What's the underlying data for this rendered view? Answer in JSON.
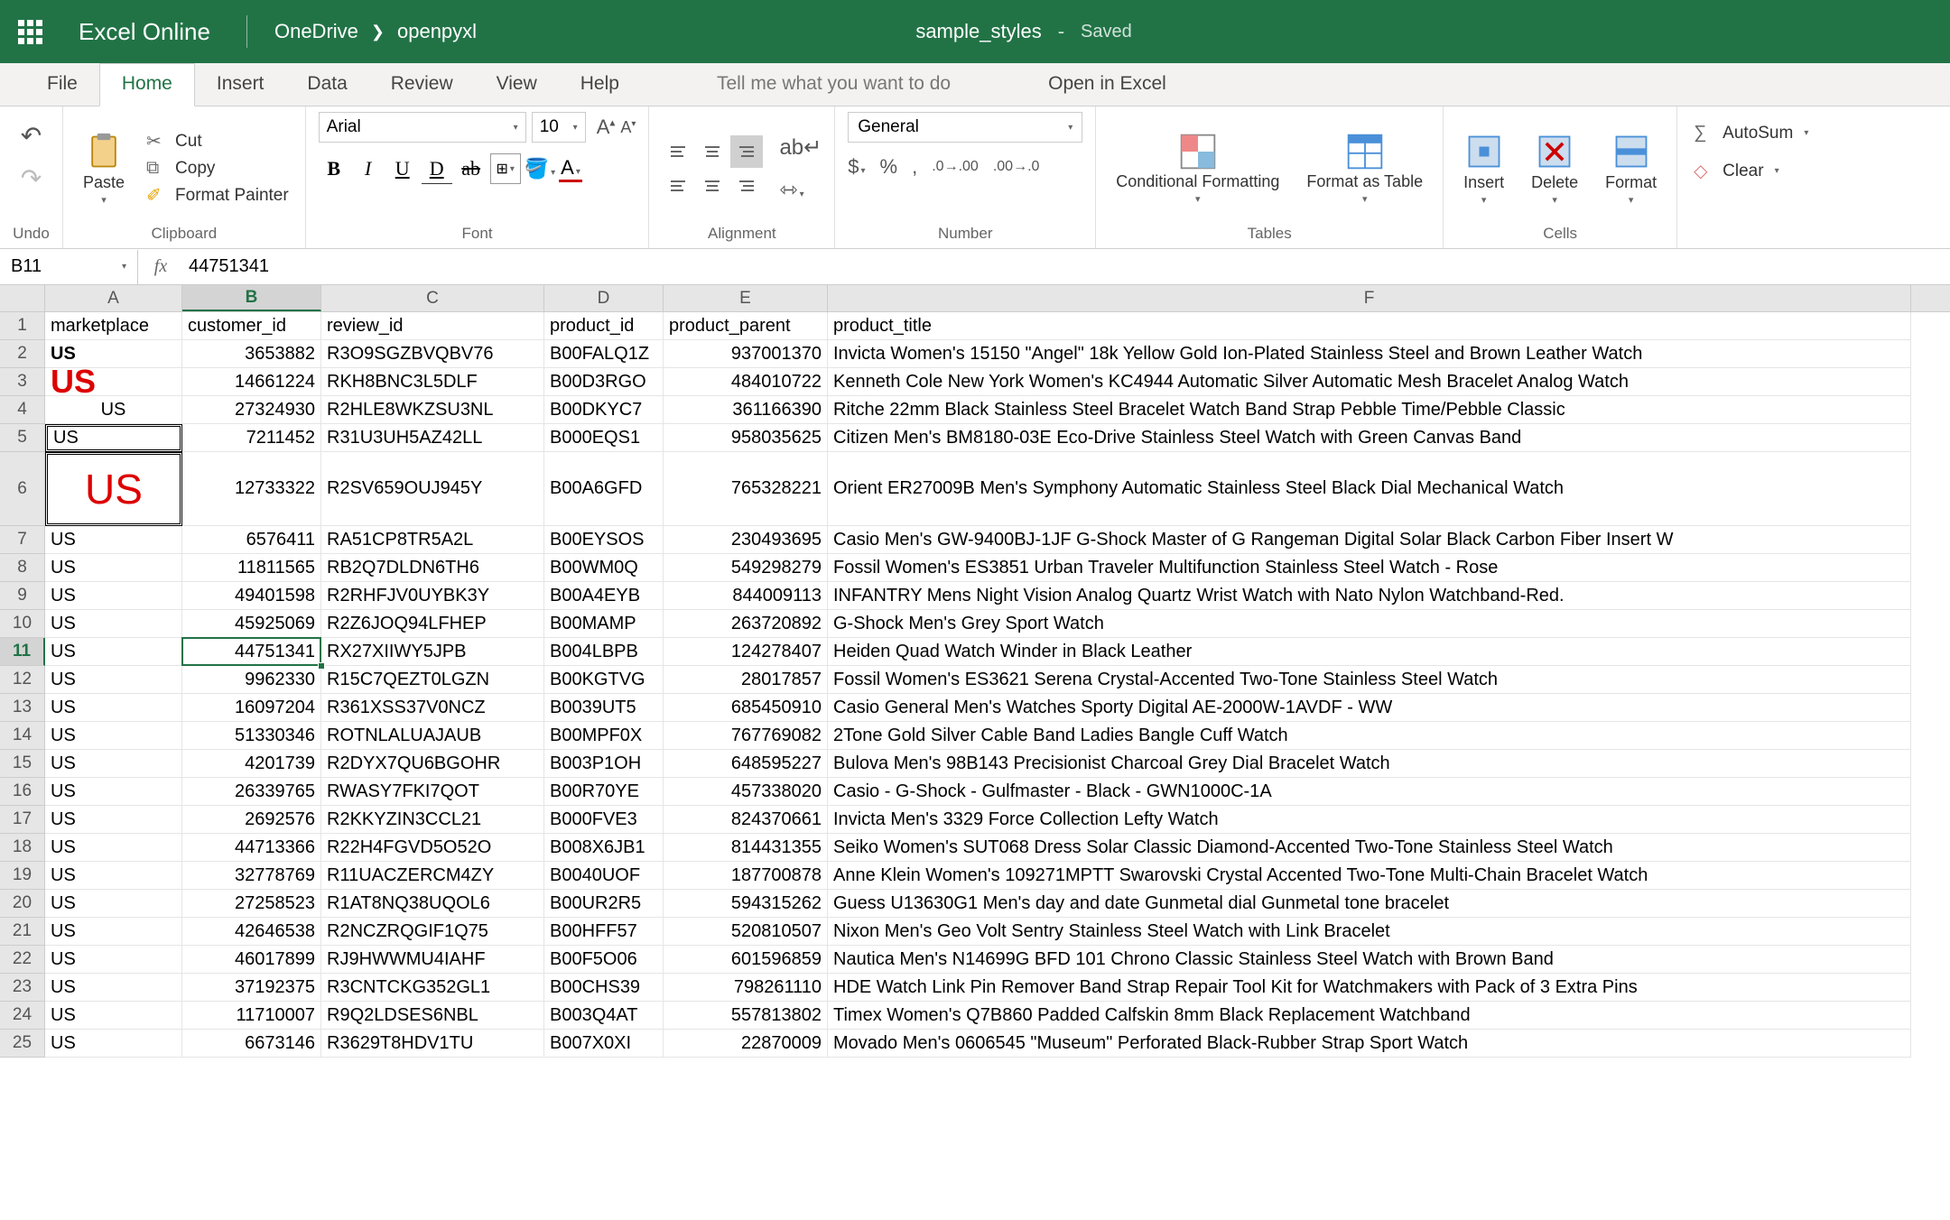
{
  "header": {
    "app_name": "Excel Online",
    "breadcrumb": [
      "OneDrive",
      "openpyxl"
    ],
    "doc_title": "sample_styles",
    "saved": "Saved"
  },
  "tabs": {
    "items": [
      "File",
      "Home",
      "Insert",
      "Data",
      "Review",
      "View",
      "Help"
    ],
    "active": "Home",
    "tellme": "Tell me what you want to do",
    "openin": "Open in Excel"
  },
  "ribbon": {
    "undo_label": "Undo",
    "paste": "Paste",
    "cut": "Cut",
    "copy": "Copy",
    "fmt_painter": "Format Painter",
    "clipboard": "Clipboard",
    "font_name": "Arial",
    "font_size": "10",
    "font_label": "Font",
    "alignment": "Alignment",
    "num_format": "General",
    "number": "Number",
    "cond_fmt": "Conditional Formatting",
    "fmt_table": "Format as Table",
    "tables": "Tables",
    "insert": "Insert",
    "delete": "Delete",
    "format": "Format",
    "cells": "Cells",
    "autosum": "AutoSum",
    "clear": "Clear"
  },
  "formula_bar": {
    "name_box": "B11",
    "fx": "fx",
    "value": "44751341"
  },
  "columns": [
    {
      "letter": "A",
      "cls": "cA"
    },
    {
      "letter": "B",
      "cls": "cB",
      "selected": true
    },
    {
      "letter": "C",
      "cls": "cC"
    },
    {
      "letter": "D",
      "cls": "cD"
    },
    {
      "letter": "E",
      "cls": "cE"
    },
    {
      "letter": "F",
      "cls": "cF"
    }
  ],
  "headers_row": [
    "marketplace",
    "customer_id",
    "review_id",
    "product_id",
    "product_parent",
    "product_title"
  ],
  "rows": [
    {
      "n": 2,
      "a": "US",
      "a_style": "bold",
      "b": "3653882",
      "c": "R3O9SGZBVQBV76",
      "d": "B00FALQ1Z",
      "e": "937001370",
      "f": "Invicta Women's 15150 \"Angel\" 18k Yellow Gold Ion-Plated Stainless Steel and Brown Leather Watch"
    },
    {
      "n": 3,
      "a": "US",
      "a_style": "red-big",
      "b": "14661224",
      "c": "RKH8BNC3L5DLF",
      "d": "B00D3RGO",
      "e": "484010722",
      "f": "Kenneth Cole New York Women's KC4944 Automatic Silver Automatic Mesh Bracelet Analog Watch"
    },
    {
      "n": 4,
      "a": "US",
      "a_style": "center",
      "b": "27324930",
      "c": "R2HLE8WKZSU3NL",
      "d": "B00DKYC7",
      "e": "361166390",
      "f": "Ritche 22mm Black Stainless Steel Bracelet Watch Band Strap Pebble Time/Pebble Classic"
    },
    {
      "n": 5,
      "a": "US",
      "a_style": "dbl-border",
      "b": "7211452",
      "c": "R31U3UH5AZ42LL",
      "d": "B000EQS1",
      "e": "958035625",
      "f": "Citizen Men's BM8180-03E Eco-Drive Stainless Steel Watch with Green Canvas Band"
    },
    {
      "n": 6,
      "tall": true,
      "a": "US",
      "a_style": "us-huge dbl-border",
      "b": "12733322",
      "c": "R2SV659OUJ945Y",
      "d": "B00A6GFD",
      "e": "765328221",
      "f": "Orient ER27009B Men's Symphony Automatic Stainless Steel Black Dial Mechanical Watch"
    },
    {
      "n": 7,
      "a": "US",
      "b": "6576411",
      "c": "RA51CP8TR5A2L",
      "d": "B00EYSOS",
      "e": "230493695",
      "f": "Casio Men's GW-9400BJ-1JF G-Shock Master of G Rangeman Digital Solar Black Carbon Fiber Insert W"
    },
    {
      "n": 8,
      "a": "US",
      "b": "11811565",
      "c": "RB2Q7DLDN6TH6",
      "d": "B00WM0Q",
      "e": "549298279",
      "f": "Fossil Women's ES3851 Urban Traveler Multifunction Stainless Steel Watch - Rose"
    },
    {
      "n": 9,
      "a": "US",
      "b": "49401598",
      "c": "R2RHFJV0UYBK3Y",
      "d": "B00A4EYB",
      "e": "844009113",
      "f": "INFANTRY Mens Night Vision Analog Quartz Wrist Watch with Nato Nylon Watchband-Red."
    },
    {
      "n": 10,
      "a": "US",
      "b": "45925069",
      "c": "R2Z6JOQ94LFHEP",
      "d": "B00MAMP",
      "e": "263720892",
      "f": "G-Shock Men's Grey Sport Watch"
    },
    {
      "n": 11,
      "sel": true,
      "a": "US",
      "b": "44751341",
      "c": "RX27XIIWY5JPB",
      "d": "B004LBPB",
      "e": "124278407",
      "f": "Heiden Quad Watch Winder in Black Leather"
    },
    {
      "n": 12,
      "a": "US",
      "b": "9962330",
      "c": "R15C7QEZT0LGZN",
      "d": "B00KGTVG",
      "e": "28017857",
      "f": "Fossil Women's ES3621 Serena Crystal-Accented Two-Tone Stainless Steel Watch"
    },
    {
      "n": 13,
      "a": "US",
      "b": "16097204",
      "c": "R361XSS37V0NCZ",
      "d": "B0039UT5",
      "e": "685450910",
      "f": "Casio General Men's Watches Sporty Digital AE-2000W-1AVDF - WW"
    },
    {
      "n": 14,
      "a": "US",
      "b": "51330346",
      "c": "ROTNLALUAJAUB",
      "d": "B00MPF0X",
      "e": "767769082",
      "f": "2Tone Gold Silver Cable Band Ladies Bangle Cuff Watch"
    },
    {
      "n": 15,
      "a": "US",
      "b": "4201739",
      "c": "R2DYX7QU6BGOHR",
      "d": "B003P1OH",
      "e": "648595227",
      "f": "Bulova Men's 98B143 Precisionist Charcoal Grey Dial Bracelet Watch"
    },
    {
      "n": 16,
      "a": "US",
      "b": "26339765",
      "c": "RWASY7FKI7QOT",
      "d": "B00R70YE",
      "e": "457338020",
      "f": "Casio - G-Shock - Gulfmaster - Black - GWN1000C-1A"
    },
    {
      "n": 17,
      "a": "US",
      "b": "2692576",
      "c": "R2KKYZIN3CCL21",
      "d": "B000FVE3",
      "e": "824370661",
      "f": "Invicta Men's 3329 Force Collection Lefty Watch"
    },
    {
      "n": 18,
      "a": "US",
      "b": "44713366",
      "c": "R22H4FGVD5O52O",
      "d": "B008X6JB1",
      "e": "814431355",
      "f": "Seiko Women's SUT068 Dress Solar Classic Diamond-Accented Two-Tone Stainless Steel Watch"
    },
    {
      "n": 19,
      "a": "US",
      "b": "32778769",
      "c": "R11UACZERCM4ZY",
      "d": "B0040UOF",
      "e": "187700878",
      "f": "Anne Klein Women's 109271MPTT Swarovski Crystal Accented Two-Tone Multi-Chain Bracelet Watch"
    },
    {
      "n": 20,
      "a": "US",
      "b": "27258523",
      "c": "R1AT8NQ38UQOL6",
      "d": "B00UR2R5",
      "e": "594315262",
      "f": "Guess U13630G1 Men's day and date Gunmetal dial Gunmetal tone bracelet"
    },
    {
      "n": 21,
      "a": "US",
      "b": "42646538",
      "c": "R2NCZRQGIF1Q75",
      "d": "B00HFF57",
      "e": "520810507",
      "f": "Nixon Men's Geo Volt Sentry Stainless Steel Watch with Link Bracelet"
    },
    {
      "n": 22,
      "a": "US",
      "b": "46017899",
      "c": "RJ9HWWMU4IAHF",
      "d": "B00F5O06",
      "e": "601596859",
      "f": "Nautica Men's N14699G BFD 101 Chrono Classic Stainless Steel Watch with Brown Band"
    },
    {
      "n": 23,
      "a": "US",
      "b": "37192375",
      "c": "R3CNTCKG352GL1",
      "d": "B00CHS39",
      "e": "798261110",
      "f": "HDE Watch Link Pin Remover Band Strap Repair Tool Kit for Watchmakers with Pack of 3 Extra Pins"
    },
    {
      "n": 24,
      "a": "US",
      "b": "11710007",
      "c": "R9Q2LDSES6NBL",
      "d": "B003Q4AT",
      "e": "557813802",
      "f": "Timex Women's Q7B860 Padded Calfskin 8mm Black Replacement Watchband"
    },
    {
      "n": 25,
      "a": "US",
      "b": "6673146",
      "c": "R3629T8HDV1TU",
      "d": "B007X0XI",
      "e": "22870009",
      "f": "Movado Men's 0606545 \"Museum\" Perforated Black-Rubber Strap Sport Watch"
    }
  ]
}
